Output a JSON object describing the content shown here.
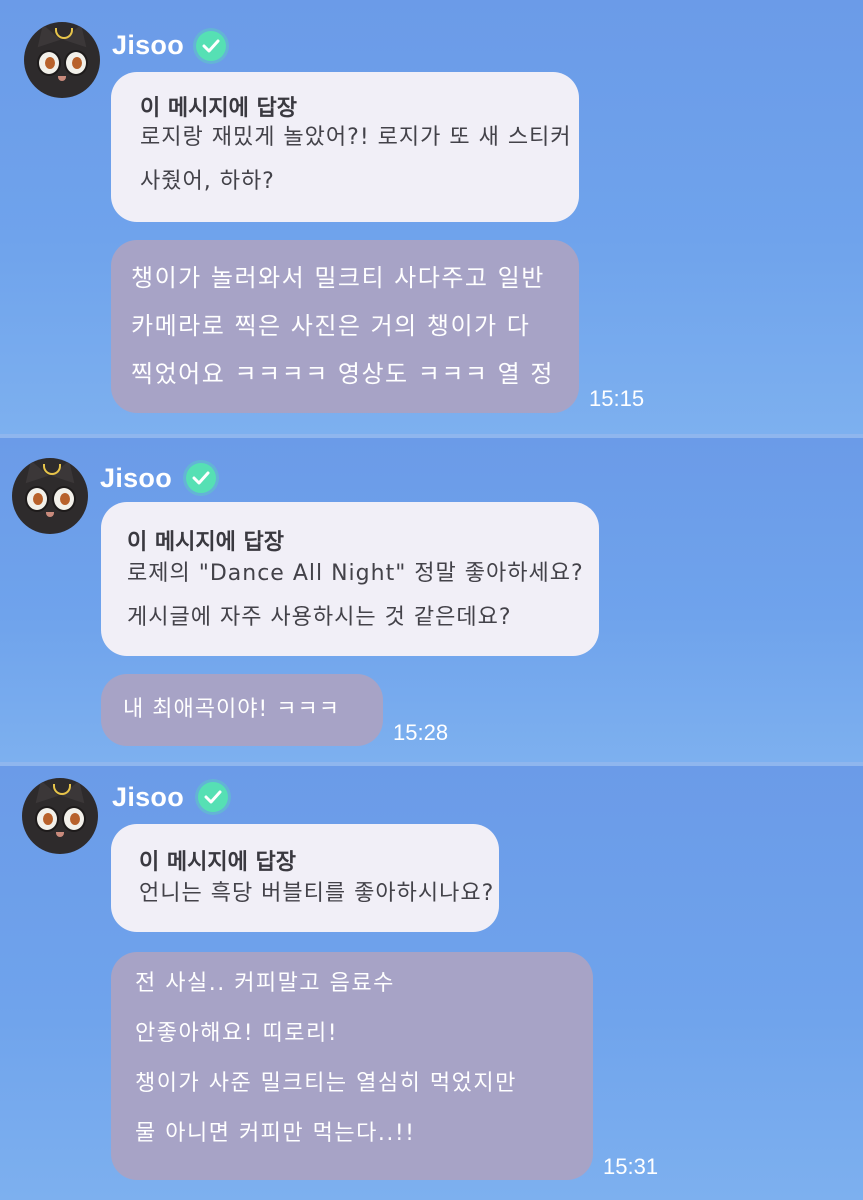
{
  "colors": {
    "background": "#6f9de8",
    "reply_bubble": "#f1eff7",
    "message_bubble": "#a7a3c6",
    "verified_badge": "#56e0b4"
  },
  "threads": [
    {
      "sender": "Jisoo",
      "reply_label": "이 메시지에 답장",
      "reply_lines": [
        "로지랑 재밌게 놀았어?! 로지가 또 새 스티커",
        "사줬어, 하하?"
      ],
      "message_lines": [
        "챙이가 놀러와서 밀크티 사다주고 일반",
        "카메라로 찍은 사진은 거의 챙이가 다",
        "찍었어요 ㅋㅋㅋㅋ 영상도 ㅋㅋㅋ 열 정"
      ],
      "time": "15:15"
    },
    {
      "sender": "Jisoo",
      "reply_label": "이 메시지에 답장",
      "reply_lines": [
        "로제의 \"Dance All Night\" 정말 좋아하세요?",
        "게시글에 자주 사용하시는 것 같은데요?"
      ],
      "message_lines": [
        "내 최애곡이야! ㅋㅋㅋ"
      ],
      "time": "15:28"
    },
    {
      "sender": "Jisoo",
      "reply_label": "이 메시지에 답장",
      "reply_lines": [
        "언니는 흑당 버블티를 좋아하시나요?"
      ],
      "message_lines": [
        "전 사실.. 커피말고 음료수",
        "안좋아해요! 띠로리!",
        "챙이가 사준 밀크티는 열심히 먹었지만",
        "물 아니면 커피만 먹는다..!!"
      ],
      "time": "15:31"
    }
  ]
}
